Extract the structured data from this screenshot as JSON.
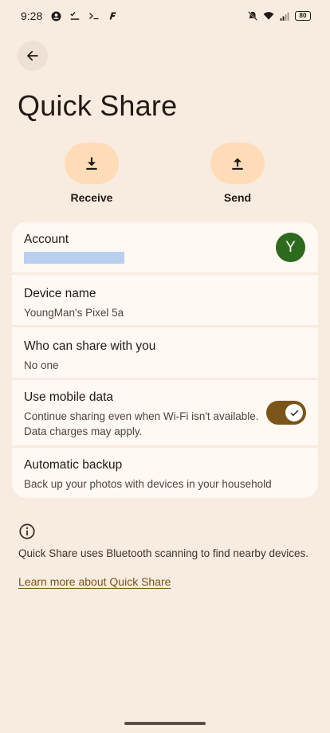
{
  "status_bar": {
    "time": "9:28",
    "battery": "80",
    "icons": [
      "account-circle-icon",
      "checklist-icon",
      "terminal-icon",
      "f-app-icon",
      "mute-icon",
      "wifi-icon",
      "signal-icon",
      "battery-icon"
    ]
  },
  "header": {
    "back_icon": "arrow-back-icon",
    "title": "Quick Share"
  },
  "actions": {
    "receive_label": "Receive",
    "send_label": "Send"
  },
  "settings": {
    "account": {
      "title": "Account",
      "avatar_letter": "Y",
      "avatar_color": "#2e6a1e"
    },
    "device_name": {
      "title": "Device name",
      "value": "YoungMan's Pixel 5a"
    },
    "who_can_share": {
      "title": "Who can share with you",
      "value": "No one"
    },
    "mobile_data": {
      "title": "Use mobile data",
      "description": "Continue sharing even when Wi-Fi isn't available. Data charges may apply.",
      "enabled": true
    },
    "backup": {
      "title": "Automatic backup",
      "description": "Back up your photos with devices in your household"
    }
  },
  "footer": {
    "info_text": "Quick Share uses Bluetooth scanning to find nearby devices.",
    "learn_more": "Learn more about Quick Share"
  },
  "colors": {
    "background": "#f8ebe0",
    "card": "#fff8f3",
    "accent": "#7b5419",
    "action_pill": "#ffdcb8"
  }
}
